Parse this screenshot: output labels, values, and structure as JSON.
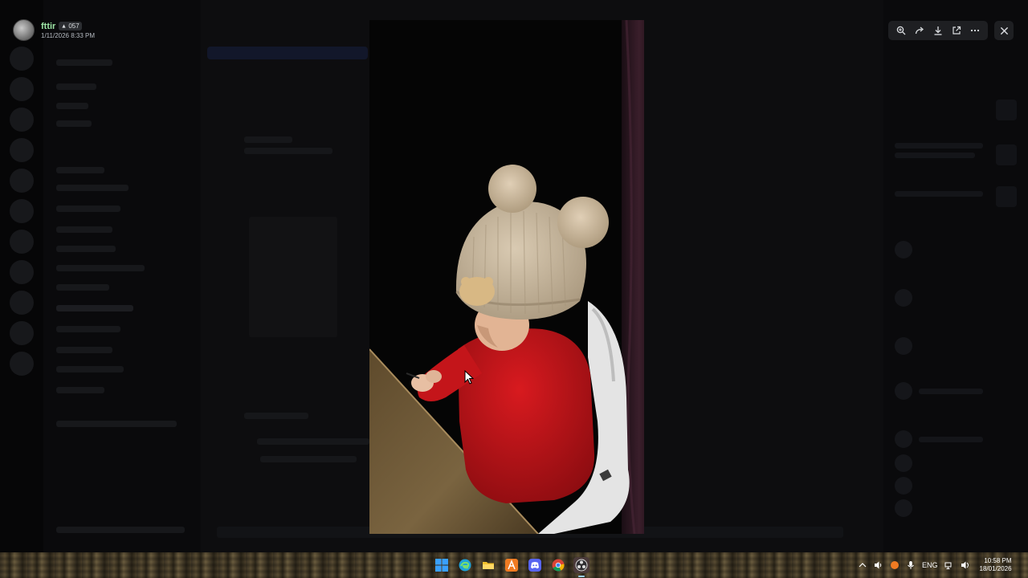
{
  "uploader": {
    "username": "fttir",
    "tag": "057",
    "timestamp": "1/11/2026 8:33 PM"
  },
  "toolbar": {
    "buttons": [
      "zoom-in-icon",
      "forward-icon",
      "download-icon",
      "open-external-icon",
      "more-icon"
    ],
    "close": "close-icon"
  },
  "photo": {
    "description_subject": "child-in-knit-hat"
  },
  "taskbar": {
    "apps": [
      "windows-start-icon",
      "edge-icon",
      "file-explorer-icon",
      "app-icon",
      "discord-icon",
      "chrome-icon",
      "obs-icon"
    ],
    "tray": {
      "language": "ENG",
      "time": "10:58 PM",
      "date": "18/01/2026"
    }
  },
  "colors": {
    "username": "#9ee6a6",
    "toolbar_bg": "#1e1f22",
    "sweater": "#c4151a",
    "hat": "#c9b9a1"
  }
}
